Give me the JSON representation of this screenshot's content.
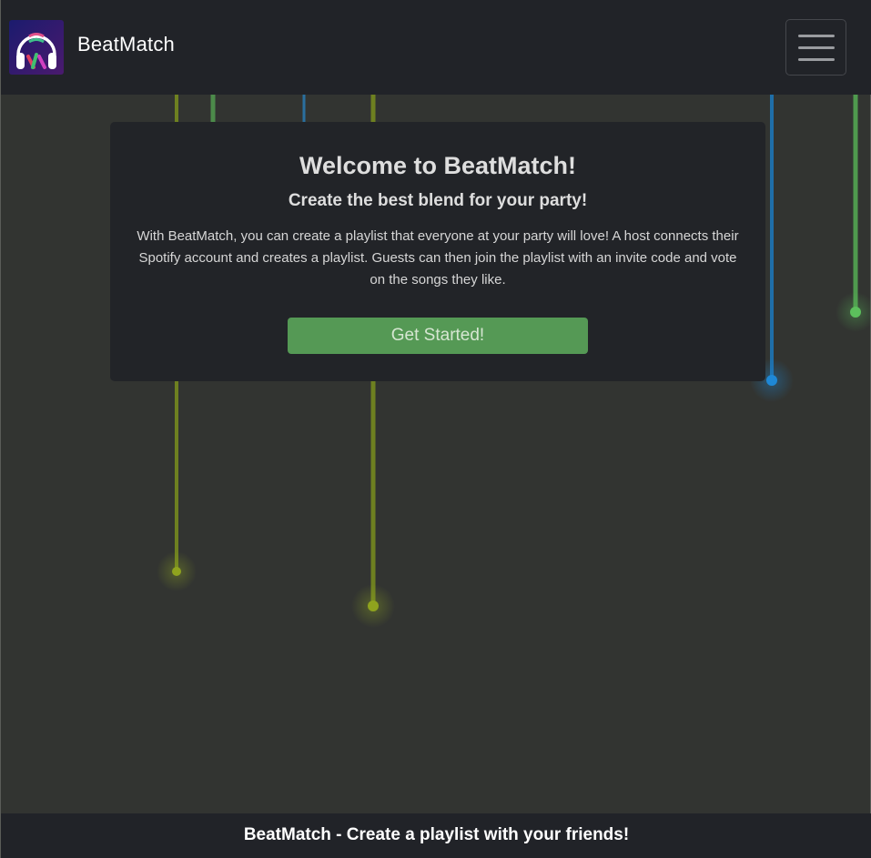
{
  "navbar": {
    "brand": "BeatMatch",
    "logo_icon": "headphones-logo-icon",
    "menu_icon": "hamburger-menu-icon"
  },
  "welcome": {
    "title": "Welcome to BeatMatch!",
    "subtitle": "Create the best blend for your party!",
    "description": "With BeatMatch, you can create a playlist that everyone at your party will love! A host connects their Spotify account and creates a playlist. Guests can then join the playlist with an invite code and vote on the songs they like.",
    "cta_label": "Get Started!"
  },
  "footer": {
    "text": "BeatMatch - Create a playlist with your friends!"
  },
  "colors": {
    "background": "#323431",
    "navbar": "#212328",
    "card": "#222428",
    "accent_green": "#559955",
    "string_green": "#5cbf5c",
    "string_yellow": "#8fa31e",
    "string_blue": "#1e88d6"
  }
}
